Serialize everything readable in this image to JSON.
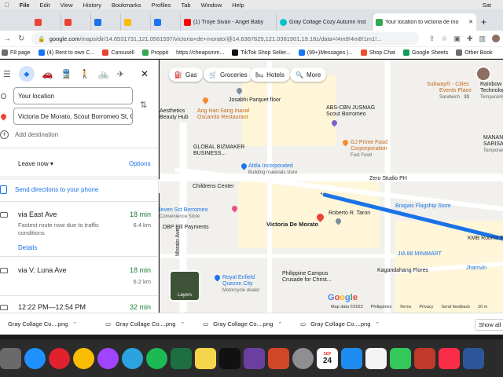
{
  "menubar": {
    "app": "File",
    "items": [
      "Edit",
      "View",
      "History",
      "Bookmarks",
      "Profiles",
      "Tab",
      "Window",
      "Help"
    ],
    "clock": "Sat"
  },
  "tabs": [
    {
      "title": "",
      "color": "#ea4335"
    },
    {
      "title": "",
      "color": "#ea4335"
    },
    {
      "title": "",
      "color": "#1a73e8"
    },
    {
      "title": "",
      "color": "#fbbc04"
    },
    {
      "title": "",
      "color": "#1877f2"
    },
    {
      "title": "(1) Troye Sivan - Angel Baby",
      "color": "#ff0000"
    },
    {
      "title": "Gray Collage Cozy Autumn Inst",
      "color": "#00c4cc"
    },
    {
      "title": "Your location to victoria de mo",
      "color": "#34a853"
    }
  ],
  "address": {
    "host": "google.com",
    "path": "/maps/dir/14.6531731,121.0561597/victoria+de+morato/@14.6367829,121.0361901,19.18z/data=!4m9!4m8!1m1!..."
  },
  "bookmarks": [
    "F8 page",
    "(4) Rent to own C...",
    "Carousell",
    "Proppit",
    "https://cheapsmm...",
    "TikTok Shop Seller...",
    "(99+)Messages |...",
    "Shop Chat",
    "Google Sheets",
    "Other Book"
  ],
  "directions": {
    "origin": "Your location",
    "destination": "Victoria De Morato, Scout Borromeo St, Quezon City",
    "add_destination": "Add destination",
    "leave": "Leave now",
    "options": "Options",
    "send": "Send directions to your phone",
    "routes": [
      {
        "via": "via East Ave",
        "time": "18 min",
        "distance": "6.4 km",
        "desc": "Fastest route now due to traffic conditions",
        "details": "Details"
      },
      {
        "via": "via V. Luna Ave",
        "time": "18 min",
        "distance": "6.2 km"
      },
      {
        "via": "12:22 PM—12:54 PM",
        "time": "32 min"
      }
    ]
  },
  "map": {
    "chips": [
      "Gas",
      "Groceries",
      "Hotels",
      "More"
    ],
    "labels": [
      "Josabhi Parquet floor",
      "Aesthetics",
      "Beauty Hub",
      "Ang Hari Sang Inasal",
      "Oscarrito Restaurant",
      "ABS-CBN JUSMAG",
      "Scout Borromeo",
      "GLOBAL BIZMAKER",
      "BUSINESS...",
      "Attila Incorporated",
      "Building materials store",
      "GJ Prime Food",
      "Corporporation",
      "Fast Food",
      "Zero Studio PH",
      "Childrens Center",
      "Bragais Flagship Store",
      "leven Sct Borromeo",
      "Convenience Store",
      "Victoria De Morato",
      "Roberto R. Taron",
      "DBP Bill Payments",
      "Morato Ave",
      "JIA 88 MINIMART",
      "KMB Rooms For R",
      "Philippine Campus",
      "Crusade for Christ...",
      "Royal Enfield",
      "Quezon City",
      "Motorcycle dealer",
      "Kagandahang Flores",
      "Jhamvin",
      "Subway® - Cities",
      "Events Place",
      "Sandwich · $$",
      "Rainbow C",
      "Technolog",
      "Temporarily c",
      "MANANG",
      "SARISARI",
      "Temporarily c",
      "Layers"
    ],
    "footer": [
      "Map data ©2022",
      "Philippines",
      "Terms",
      "Privacy",
      "Send feedback",
      "20 m"
    ],
    "google": "Google",
    "route_color": "#1a73e8"
  },
  "downloads": {
    "items": [
      "Gray Collage Co....png",
      "Gray Collage Co....png",
      "Gray Collage Co....png",
      "Gray Collage Co....png"
    ],
    "show_all": "Show all"
  },
  "dock": {
    "calendar_month": "SEP",
    "calendar_day": "24",
    "apps": [
      {
        "name": "launchpad",
        "color": "#6a6a6a"
      },
      {
        "name": "safari",
        "color": "#1e90ff"
      },
      {
        "name": "opera",
        "color": "#e0212e"
      },
      {
        "name": "chrome",
        "color": "#fbbc04"
      },
      {
        "name": "messenger",
        "color": "#a044ff"
      },
      {
        "name": "telegram",
        "color": "#2aa3e0"
      },
      {
        "name": "spotify",
        "color": "#1db954"
      },
      {
        "name": "excel",
        "color": "#1d6f42"
      },
      {
        "name": "notes",
        "color": "#f5d54b"
      },
      {
        "name": "tiktok",
        "color": "#111111"
      },
      {
        "name": "imovie",
        "color": "#6b3fa0"
      },
      {
        "name": "powerpoint",
        "color": "#d24726"
      },
      {
        "name": "system-preferences",
        "color": "#8e8e93"
      },
      {
        "name": "calendar",
        "color": "#ffffff"
      },
      {
        "name": "app-store",
        "color": "#1c8cf0"
      },
      {
        "name": "photos",
        "color": "#f4f4f4"
      },
      {
        "name": "messages",
        "color": "#34c759"
      },
      {
        "name": "pdf",
        "color": "#c0392b"
      },
      {
        "name": "music",
        "color": "#fa2d48"
      },
      {
        "name": "word",
        "color": "#2b579a"
      }
    ]
  }
}
